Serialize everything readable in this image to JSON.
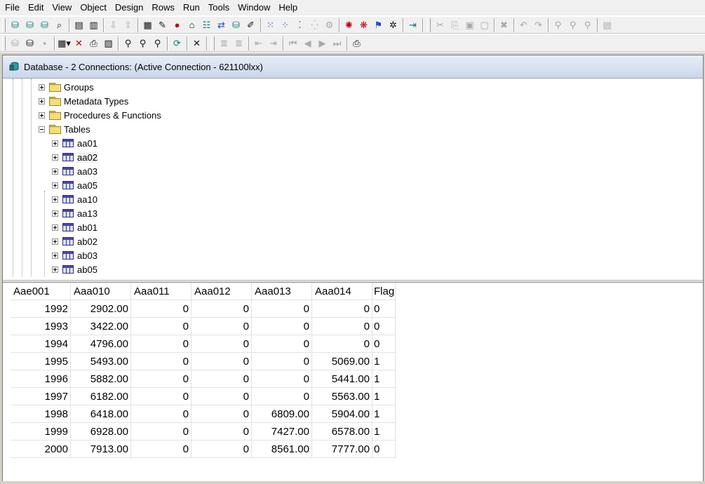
{
  "menu": [
    "File",
    "Edit",
    "View",
    "Object",
    "Design",
    "Rows",
    "Run",
    "Tools",
    "Window",
    "Help"
  ],
  "toolbar1_icons": [
    "connect-icon",
    "disconnect-icon",
    "new-connection-icon",
    "find-object-icon",
    "window-layout-icon",
    "split-view-icon",
    "import-icon",
    "export-icon",
    "query-builder-icon",
    "run-script-icon",
    "run-statement-icon",
    "bank-icon",
    "schema-icon",
    "sync-icon",
    "database-icon",
    "edit-icon",
    "grid-icon",
    "chart-icon",
    "diagram-icon",
    "lock-icon",
    "settings-icon",
    "stop-icon",
    "debug-icon",
    "run-icon",
    "explain-icon",
    "exit-icon",
    "cut-icon",
    "copy-icon",
    "paste-icon",
    "paste-special-icon",
    "delete-icon",
    "undo-icon",
    "redo-icon",
    "find-icon",
    "find-next-icon",
    "replace-icon",
    "report-icon"
  ],
  "toolbar2_icons": [
    "open-icon",
    "save-all-icon",
    "save-icon",
    "grid-view-icon",
    "delete-row-icon",
    "print-preview-icon",
    "properties-icon",
    "zoom-icon",
    "zoom-in-icon",
    "zoom-out-icon",
    "refresh-icon",
    "close-icon",
    "insert-row-icon",
    "append-row-icon",
    "indent-icon",
    "outdent-icon",
    "first-record-icon",
    "prev-record-icon",
    "next-record-icon",
    "last-record-icon",
    "print-icon"
  ],
  "window": {
    "title": "Database - 2 Connections: (Active Connection - 621100lxx)"
  },
  "tree": {
    "folders": [
      {
        "label": "Groups",
        "expanded": false
      },
      {
        "label": "Metadata Types",
        "expanded": false
      },
      {
        "label": "Procedures & Functions",
        "expanded": false
      },
      {
        "label": "Tables",
        "expanded": true
      }
    ],
    "tables": [
      "aa01",
      "aa02",
      "aa03",
      "aa05",
      "aa10",
      "aa13",
      "ab01",
      "ab02",
      "ab03",
      "ab05"
    ],
    "selected": "aa02"
  },
  "grid": {
    "columns": [
      "Aae001",
      "Aaa010",
      "Aaa011",
      "Aaa012",
      "Aaa013",
      "Aaa014",
      "Flag"
    ],
    "rows": [
      [
        "1992",
        "2902.00",
        "0",
        "0",
        "0",
        "0",
        "0"
      ],
      [
        "1993",
        "3422.00",
        "0",
        "0",
        "0",
        "0",
        "0"
      ],
      [
        "1994",
        "4796.00",
        "0",
        "0",
        "0",
        "0",
        "0"
      ],
      [
        "1995",
        "5493.00",
        "0",
        "0",
        "0",
        "5069.00",
        "1"
      ],
      [
        "1996",
        "5882.00",
        "0",
        "0",
        "0",
        "5441.00",
        "1"
      ],
      [
        "1997",
        "6182.00",
        "0",
        "0",
        "0",
        "5563.00",
        "1"
      ],
      [
        "1998",
        "6418.00",
        "0",
        "0",
        "6809.00",
        "5904.00",
        "1"
      ],
      [
        "1999",
        "6928.00",
        "0",
        "0",
        "7427.00",
        "6578.00",
        "1"
      ],
      [
        "2000",
        "7913.00",
        "0",
        "0",
        "8561.00",
        "7777.00",
        "0"
      ]
    ]
  }
}
